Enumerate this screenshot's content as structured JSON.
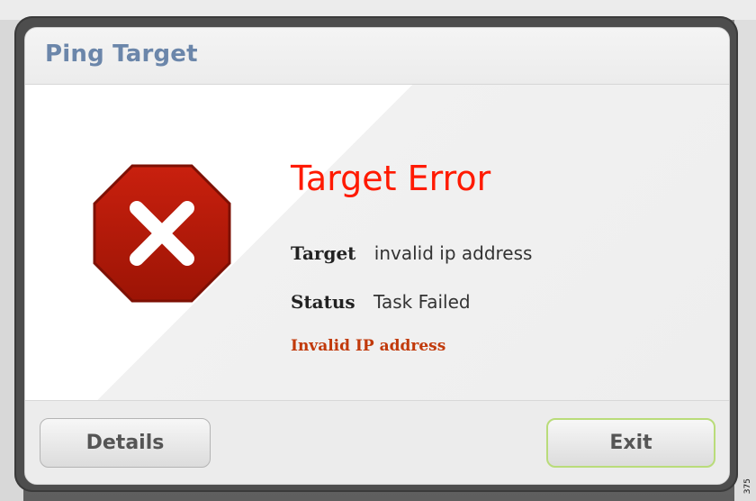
{
  "dialog": {
    "title": "Ping Target",
    "headline": "Target Error",
    "target_label": "Target",
    "target_value": "invalid ip address",
    "status_label": "Status",
    "status_value": "Task Failed",
    "error_message": "Invalid IP address",
    "icon": "stop-error-icon"
  },
  "buttons": {
    "details_label": "Details",
    "exit_label": "Exit"
  },
  "colors": {
    "title": "#6b86aa",
    "headline": "#ff1a00",
    "error_message": "#c1390a",
    "stop_icon": "#b21a0b",
    "exit_border": "#b9dc7a"
  },
  "figure_id": "375"
}
